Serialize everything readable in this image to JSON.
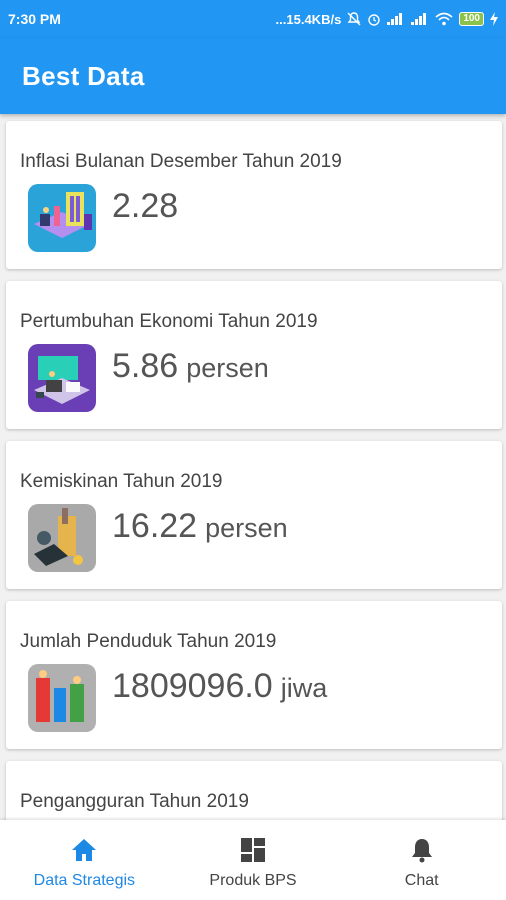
{
  "status_bar": {
    "time": "7:30 PM",
    "network_speed": "...15.4KB/s",
    "battery": "100",
    "icons": [
      "mute-icon",
      "alarm-icon",
      "signal-icon",
      "signal-icon",
      "wifi-icon",
      "battery-icon",
      "charging-icon"
    ]
  },
  "app_bar": {
    "title": "Best Data"
  },
  "cards": [
    {
      "title": "Inflasi Bulanan Desember Tahun 2019",
      "value": "2.28",
      "unit": ""
    },
    {
      "title": "Pertumbuhan Ekonomi Tahun 2019",
      "value": "5.86",
      "unit": "persen"
    },
    {
      "title": "Kemiskinan Tahun 2019",
      "value": "16.22",
      "unit": "persen"
    },
    {
      "title": "Jumlah Penduduk Tahun 2019",
      "value": "1809096.0",
      "unit": "jiwa"
    },
    {
      "title": "Pengangguran Tahun 2019",
      "value": "",
      "unit": ""
    }
  ],
  "bottom_nav": [
    {
      "label": "Data Strategis",
      "icon": "home-icon",
      "active": true
    },
    {
      "label": "Produk BPS",
      "icon": "dashboard-icon",
      "active": false
    },
    {
      "label": "Chat",
      "icon": "bell-icon",
      "active": false
    }
  ],
  "colors": {
    "primary": "#2196f3",
    "active_nav": "#1e88e5",
    "text": "#444444"
  }
}
